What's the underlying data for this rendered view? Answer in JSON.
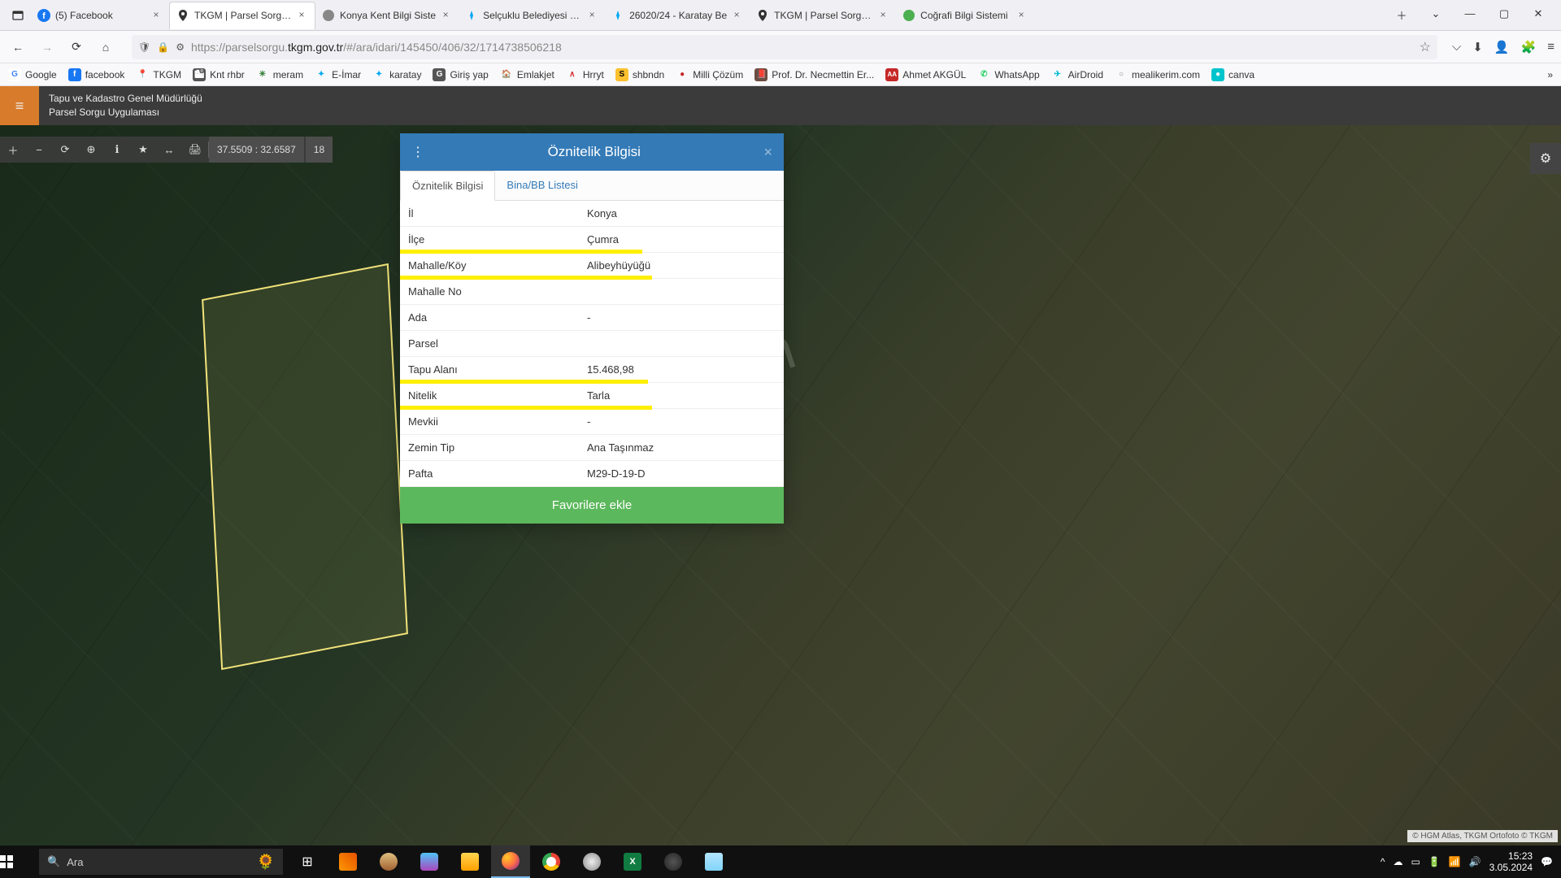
{
  "tabs": [
    {
      "title": "(5) Facebook"
    },
    {
      "title": "TKGM | Parsel Sorgu U"
    },
    {
      "title": "Konya Kent Bilgi Siste"
    },
    {
      "title": "Selçuklu Belediyesi - E"
    },
    {
      "title": "26020/24 - Karatay Be"
    },
    {
      "title": "TKGM | Parsel Sorgu U"
    },
    {
      "title": "Coğrafi Bilgi Sistemi"
    }
  ],
  "url": {
    "prefix": "https://parselsorgu.",
    "host": "tkgm.gov.tr",
    "path": "/#/ara/idari/145450/406/32/1714738506218"
  },
  "bookmarks": [
    {
      "label": "Google",
      "color": "#4285f4",
      "initial": "G"
    },
    {
      "label": "facebook",
      "color": "#1877f2",
      "initial": "f"
    },
    {
      "label": "TKGM",
      "color": "#000",
      "initial": "📍"
    },
    {
      "label": "Knt rhbr",
      "color": "#444",
      "initial": "🏙"
    },
    {
      "label": "meram",
      "color": "#2e7d32",
      "initial": "✳"
    },
    {
      "label": "E-İmar",
      "color": "#03a9f4",
      "initial": "✦"
    },
    {
      "label": "karatay",
      "color": "#03a9f4",
      "initial": "✦"
    },
    {
      "label": "Giriş yap",
      "color": "#555",
      "initial": "G"
    },
    {
      "label": "Emlakjet",
      "color": "#2e7d32",
      "initial": "🏠"
    },
    {
      "label": "Hrryt",
      "color": "#d32f2f",
      "initial": "H"
    },
    {
      "label": "shbndn",
      "color": "#fbc02d",
      "initial": "S"
    },
    {
      "label": "Milli Çözüm",
      "color": "#c62828",
      "initial": "●"
    },
    {
      "label": "Prof. Dr. Necmettin Er...",
      "color": "#6d4c41",
      "initial": "📕"
    },
    {
      "label": "Ahmet AKGÜL",
      "color": "#c62828",
      "initial": "AA"
    },
    {
      "label": "WhatsApp",
      "color": "#25d366",
      "initial": "✆"
    },
    {
      "label": "AirDroid",
      "color": "#00bcd4",
      "initial": "✈"
    },
    {
      "label": "mealikerim.com",
      "color": "#888",
      "initial": "○"
    },
    {
      "label": "canva",
      "color": "#00c4cc",
      "initial": "●"
    }
  ],
  "app_header": {
    "line1": "Tapu ve Kadastro Genel Müdürlüğü",
    "line2": "Parsel Sorgu Uygulaması"
  },
  "map_toolbar": {
    "coords": "37.5509 : 32.6587",
    "zoom": "18"
  },
  "watermark": "emlakjet.com",
  "attribution": "© HGM Atlas, TKGM Ortofoto © TKGM",
  "modal": {
    "title": "Öznitelik Bilgisi",
    "tabs": {
      "attrs": "Öznitelik Bilgisi",
      "bina": "Bina/BB Listesi"
    },
    "rows": [
      {
        "k": "İl",
        "v": "Konya"
      },
      {
        "k": "İlçe",
        "v": "Çumra"
      },
      {
        "k": "Mahalle/Köy",
        "v": "Alibeyhüyüğü"
      },
      {
        "k": "Mahalle No",
        "v": ""
      },
      {
        "k": "Ada",
        "v": "-"
      },
      {
        "k": "Parsel",
        "v": ""
      },
      {
        "k": "Tapu Alanı",
        "v": "15.468,98"
      },
      {
        "k": "Nitelik",
        "v": "Tarla"
      },
      {
        "k": "Mevkii",
        "v": "-"
      },
      {
        "k": "Zemin Tip",
        "v": "Ana Taşınmaz"
      },
      {
        "k": "Pafta",
        "v": "M29-D-19-D"
      }
    ],
    "footer": "Favorilere ekle"
  },
  "taskbar": {
    "search_placeholder": "Ara",
    "time": "15:23",
    "date": "3.05.2024"
  }
}
